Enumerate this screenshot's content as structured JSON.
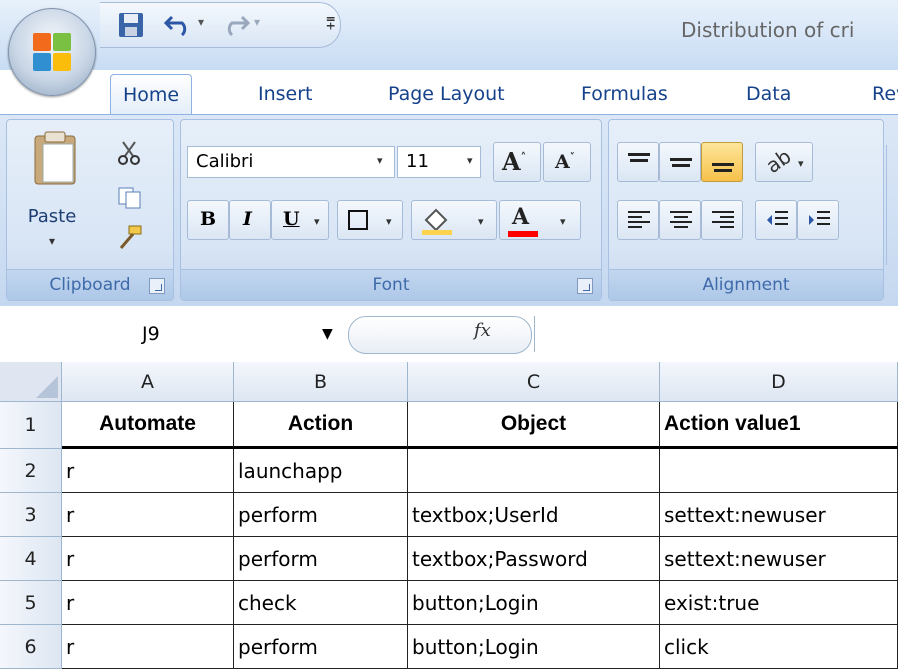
{
  "window": {
    "title": "Distribution of cri"
  },
  "ribbon_tabs": [
    "Home",
    "Insert",
    "Page Layout",
    "Formulas",
    "Data",
    "Rev"
  ],
  "active_tab": "Home",
  "clipboard": {
    "paste_label": "Paste",
    "group_label": "Clipboard"
  },
  "font": {
    "name": "Calibri",
    "size": "11",
    "group_label": "Font"
  },
  "alignment": {
    "group_label": "Alignment"
  },
  "formula_bar": {
    "name_box": "J9",
    "fx_label": "fx",
    "value": ""
  },
  "sheet": {
    "columns": [
      "A",
      "B",
      "C",
      "D"
    ],
    "rows": [
      {
        "num": "1",
        "cells": [
          "Automate",
          "Action",
          "Object",
          "Action value1"
        ]
      },
      {
        "num": "2",
        "cells": [
          "r",
          "launchapp",
          "",
          ""
        ]
      },
      {
        "num": "3",
        "cells": [
          "r",
          "perform",
          "textbox;UserId",
          "settext:newuser"
        ]
      },
      {
        "num": "4",
        "cells": [
          "r",
          "perform",
          "textbox;Password",
          "settext:newuser"
        ]
      },
      {
        "num": "5",
        "cells": [
          "r",
          "check",
          "button;Login",
          "exist:true"
        ]
      },
      {
        "num": "6",
        "cells": [
          "r",
          "perform",
          "button;Login",
          "click"
        ]
      }
    ]
  },
  "colors": {
    "accent": "#15428b",
    "ribbon": "#d6e5f7",
    "font_color_bar": "#ff0000",
    "highlight": "#fcd34d"
  }
}
